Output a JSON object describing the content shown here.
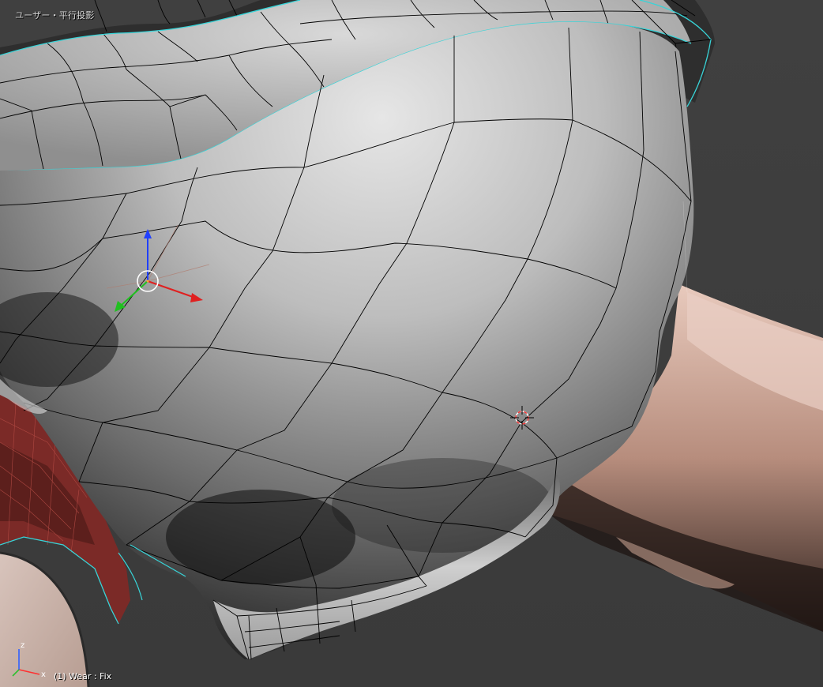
{
  "viewport": {
    "view_label": "ユーザー・平行投影",
    "object_label": "(1) Wear : Fix",
    "background_color": "#3d3d3d",
    "mesh_color": "#9a9a9a",
    "edge_color": "#000000",
    "selection_outline_color": "#38d4d8",
    "skin_color": "#c9a596",
    "cloth_red_color": "#7a2a26"
  },
  "gizmo": {
    "x_axis_color": "#e02020",
    "y_axis_color": "#20c020",
    "z_axis_color": "#2040ff",
    "center_ring": "rotation-pivot-icon"
  },
  "axes_widget": {
    "x_label": "x",
    "z_label": "z",
    "x_color": "#ff3030",
    "z_color": "#3060ff",
    "y_color": "#30c030"
  },
  "cursor": {
    "icon": "3d-cursor-icon",
    "ring_colors": [
      "#ff3030",
      "#ffffff"
    ]
  }
}
